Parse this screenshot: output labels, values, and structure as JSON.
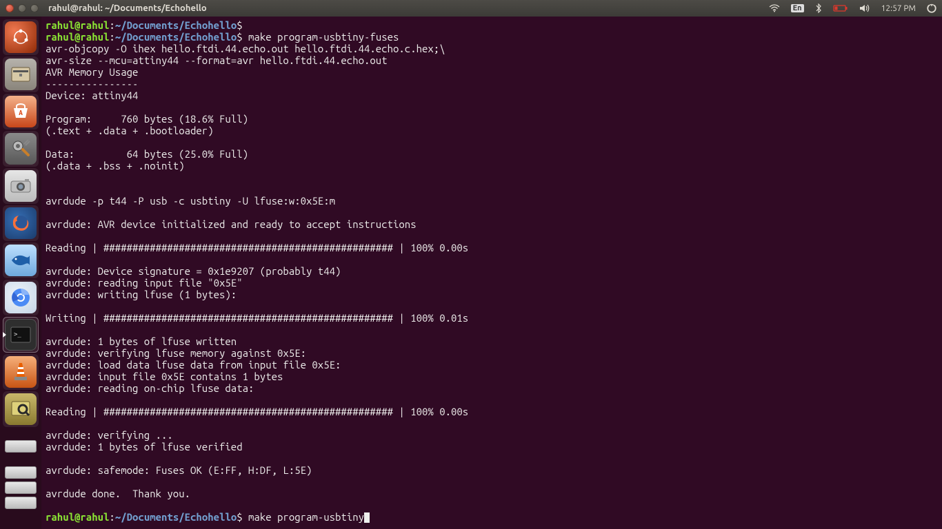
{
  "menubar": {
    "title": "rahul@rahul: ~/Documents/Echohello",
    "language": "En",
    "time": "12:57 PM"
  },
  "launcher": {
    "items": [
      {
        "name": "dash",
        "color": "#dd4814"
      },
      {
        "name": "files",
        "color": "#a9a9a9"
      },
      {
        "name": "software-center",
        "color": "#e95420"
      },
      {
        "name": "settings",
        "color": "#6b6b6b"
      },
      {
        "name": "shotwell",
        "color": "#cfcfcf"
      },
      {
        "name": "firefox",
        "color": "#ff7139"
      },
      {
        "name": "bluefish",
        "color": "#4a90d9"
      },
      {
        "name": "chromium",
        "color": "#4c8bf5"
      },
      {
        "name": "terminal",
        "color": "#2e2e2e"
      },
      {
        "name": "vlc",
        "color": "#e85e00"
      },
      {
        "name": "image-viewer",
        "color": "#828282"
      }
    ]
  },
  "terminal": {
    "user": "rahul@rahul",
    "sep": ":",
    "path": "~/Documents/Echohello",
    "prompt_suffix": "$",
    "cmd1": " make program-usbtiny-fuses",
    "cmd2": " make program-usbtiny",
    "lines": [
      "avr-objcopy -O ihex hello.ftdi.44.echo.out hello.ftdi.44.echo.c.hex;\\\\",
      "avr-size --mcu=attiny44 --format=avr hello.ftdi.44.echo.out",
      "AVR Memory Usage",
      "----------------",
      "Device: attiny44",
      "",
      "Program:     760 bytes (18.6% Full)",
      "(.text + .data + .bootloader)",
      "",
      "Data:         64 bytes (25.0% Full)",
      "(.data + .bss + .noinit)",
      "",
      "",
      "avrdude -p t44 -P usb -c usbtiny -U lfuse:w:0x5E:m",
      "",
      "avrdude: AVR device initialized and ready to accept instructions",
      "",
      "Reading | ################################################## | 100% 0.00s",
      "",
      "avrdude: Device signature = 0x1e9207 (probably t44)",
      "avrdude: reading input file \"0x5E\"",
      "avrdude: writing lfuse (1 bytes):",
      "",
      "Writing | ################################################## | 100% 0.01s",
      "",
      "avrdude: 1 bytes of lfuse written",
      "avrdude: verifying lfuse memory against 0x5E:",
      "avrdude: load data lfuse data from input file 0x5E:",
      "avrdude: input file 0x5E contains 1 bytes",
      "avrdude: reading on-chip lfuse data:",
      "",
      "Reading | ################################################## | 100% 0.00s",
      "",
      "avrdude: verifying ...",
      "avrdude: 1 bytes of lfuse verified",
      "",
      "avrdude: safemode: Fuses OK (E:FF, H:DF, L:5E)",
      "",
      "avrdude done.  Thank you.",
      ""
    ]
  }
}
